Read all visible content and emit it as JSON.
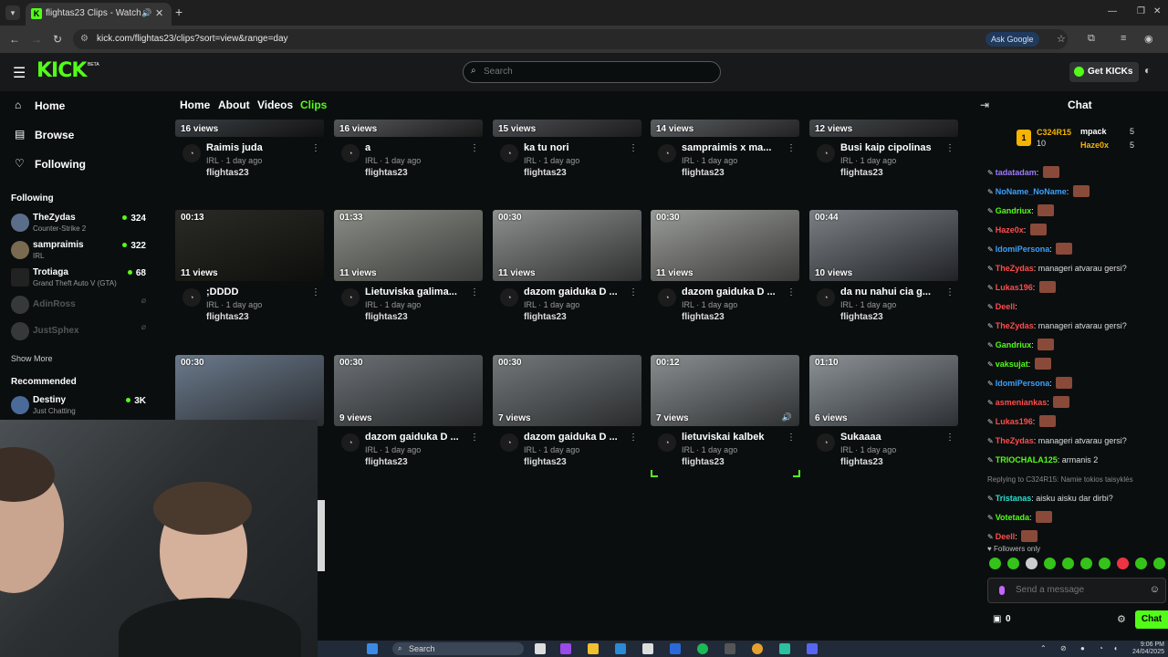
{
  "browser": {
    "tab_title": "flightas23 Clips - Watch Live",
    "url": "kick.com/flightas23/clips?sort=view&range=day",
    "ask_google": "Ask Google"
  },
  "header": {
    "logo": "KICK",
    "logo_badge": "BETA",
    "search_placeholder": "Search",
    "get_kicks": "Get KICKs"
  },
  "sidebar": {
    "nav": [
      {
        "label": "Home",
        "icon": "home-icon"
      },
      {
        "label": "Browse",
        "icon": "browse-icon"
      },
      {
        "label": "Following",
        "icon": "heart-icon"
      }
    ],
    "following_heading": "Following",
    "following": [
      {
        "name": "TheZydas",
        "game": "Counter-Strike 2",
        "viewers": "324",
        "live": true,
        "color": "#5a6e8a"
      },
      {
        "name": "sampraimis",
        "game": "IRL",
        "viewers": "322",
        "live": true,
        "color": "#7a6a50"
      },
      {
        "name": "Trotiaga",
        "game": "Grand Theft Auto V (GTA)",
        "viewers": "68",
        "live": true,
        "color": "#222222"
      },
      {
        "name": "AdinRoss",
        "game": "",
        "viewers": "",
        "live": false,
        "color": "#8a8a8a"
      },
      {
        "name": "JustSphex",
        "game": "",
        "viewers": "",
        "live": false,
        "color": "#8a8a8a"
      }
    ],
    "show_more": "Show More",
    "recommended_heading": "Recommended",
    "recommended": [
      {
        "name": "Destiny",
        "game": "Just Chatting",
        "viewers": "3K",
        "live": true,
        "color": "#4a6a9a"
      }
    ]
  },
  "profile_tabs": [
    {
      "label": "Home",
      "active": false
    },
    {
      "label": "About",
      "active": false
    },
    {
      "label": "Videos",
      "active": false
    },
    {
      "label": "Clips",
      "active": true
    }
  ],
  "clips": [
    {
      "duration": "",
      "views": "16 views",
      "title": "Raimis juda",
      "meta": "IRL · 1 day ago",
      "channel": "flightas23",
      "thumb": [
        "#3a3f44",
        "#111"
      ]
    },
    {
      "duration": "",
      "views": "16 views",
      "title": "a",
      "meta": "IRL · 1 day ago",
      "channel": "flightas23",
      "thumb": [
        "#55585a",
        "#1a1a1a"
      ]
    },
    {
      "duration": "",
      "views": "15 views",
      "title": "ka tu nori",
      "meta": "IRL · 1 day ago",
      "channel": "flightas23",
      "thumb": [
        "#4a4d52",
        "#1c1c1c"
      ]
    },
    {
      "duration": "",
      "views": "14 views",
      "title": "sampraimis x ma...",
      "meta": "IRL · 1 day ago",
      "channel": "flightas23",
      "thumb": [
        "#5a5e62",
        "#222"
      ]
    },
    {
      "duration": "",
      "views": "12 views",
      "title": "Busi kaip cipolinas",
      "meta": "IRL · 1 day ago",
      "channel": "flightas23",
      "thumb": [
        "#44484c",
        "#1a1a1a"
      ]
    },
    {
      "duration": "00:13",
      "views": "11 views",
      "title": ";DDDD",
      "meta": "IRL · 1 day ago",
      "channel": "flightas23",
      "thumb": [
        "#2a2a26",
        "#0e0e0c"
      ]
    },
    {
      "duration": "01:33",
      "views": "11 views",
      "title": "Lietuviska galima...",
      "meta": "IRL · 1 day ago",
      "channel": "flightas23",
      "thumb": [
        "#8a8c86",
        "#3a3c3a"
      ]
    },
    {
      "duration": "00:30",
      "views": "11 views",
      "title": "dazom gaiduka D ...",
      "meta": "IRL · 1 day ago",
      "channel": "flightas23",
      "thumb": [
        "#8e9090",
        "#2e3030"
      ]
    },
    {
      "duration": "00:30",
      "views": "11 views",
      "title": "dazom gaiduka D ...",
      "meta": "IRL · 1 day ago",
      "channel": "flightas23",
      "thumb": [
        "#9a9c9a",
        "#3a3a38"
      ]
    },
    {
      "duration": "00:44",
      "views": "10 views",
      "title": "da nu nahui cia g...",
      "meta": "IRL · 1 day ago",
      "channel": "flightas23",
      "thumb": [
        "#7c8084",
        "#202226"
      ]
    },
    {
      "duration": "00:30",
      "views": "",
      "title": "",
      "meta": "",
      "channel": "",
      "thumb": [
        "#6a7a8c",
        "#2a2c30"
      ]
    },
    {
      "duration": "00:30",
      "views": "9 views",
      "title": "dazom gaiduka D ...",
      "meta": "IRL · 1 day ago",
      "channel": "flightas23",
      "thumb": [
        "#6c7074",
        "#26282a"
      ]
    },
    {
      "duration": "00:30",
      "views": "7 views",
      "title": "dazom gaiduka D ...",
      "meta": "IRL · 1 day ago",
      "channel": "flightas23",
      "thumb": [
        "#74787a",
        "#2a2c2e"
      ]
    },
    {
      "duration": "00:12",
      "views": "7 views",
      "title": "lietuviskai kalbek",
      "meta": "IRL · 1 day ago",
      "channel": "flightas23",
      "thumb": [
        "#8a8e90",
        "#2e3032"
      ]
    },
    {
      "duration": "01:10",
      "views": "6 views",
      "title": "Sukaaaa",
      "meta": "IRL · 1 day ago",
      "channel": "flightas23",
      "thumb": [
        "#8c9296",
        "#2c3034"
      ]
    }
  ],
  "chat": {
    "title": "Chat",
    "pinned": [
      {
        "name": "C324R15",
        "count": "10",
        "color": "#f5b400"
      },
      {
        "name": "mpack",
        "count": "5",
        "color": "#ffffff"
      },
      {
        "name": "Haze0x",
        "count": "5",
        "color": "#f5b400"
      }
    ],
    "messages": [
      {
        "user": "tadatadam",
        "color": "#9a7cff",
        "text": "",
        "emote": true
      },
      {
        "user": "NoName_NoName",
        "color": "#3aa0ff",
        "text": "",
        "emote": true
      },
      {
        "user": "Gandriux",
        "color": "#53fc18",
        "text": "",
        "emote": true
      },
      {
        "user": "Haze0x",
        "color": "#ff4d4d",
        "text": "",
        "emote": true
      },
      {
        "user": "IdomiPersona",
        "color": "#3aa0ff",
        "text": "",
        "emote": true
      },
      {
        "user": "TheZydas",
        "color": "#ff4d4d",
        "text": "manageri atvarau gersi?",
        "emote": false
      },
      {
        "user": "Lukas196",
        "color": "#ff4d4d",
        "text": "",
        "emote": true
      },
      {
        "user": "Deell",
        "color": "#ff4d4d",
        "text": "",
        "emote": false
      },
      {
        "user": "TheZydas",
        "color": "#ff4d4d",
        "text": "manageri atvarau gersi?",
        "emote": false
      },
      {
        "user": "Gandriux",
        "color": "#53fc18",
        "text": "",
        "emote": true
      },
      {
        "user": "vaksujat",
        "color": "#53fc18",
        "text": "",
        "emote": true
      },
      {
        "user": "IdomiPersona",
        "color": "#3aa0ff",
        "text": "",
        "emote": true
      },
      {
        "user": "asmeniankas",
        "color": "#ff4d4d",
        "text": "",
        "emote": true
      },
      {
        "user": "Lukas196",
        "color": "#ff4d4d",
        "text": "",
        "emote": true
      },
      {
        "user": "TheZydas",
        "color": "#ff4d4d",
        "text": "manageri atvarau gersi?",
        "emote": false
      },
      {
        "user": "TRIOCHALA125",
        "color": "#53fc18",
        "text": "armanis 2",
        "emote": false
      },
      {
        "user": "Replying to C324R15: Namie tokios taisyklės",
        "color": "#888888",
        "text": "",
        "emote": false
      },
      {
        "user": "Tristanas",
        "color": "#2be0d0",
        "text": "aisku aisku dar dirbi?",
        "emote": false
      },
      {
        "user": "Votetada",
        "color": "#53fc18",
        "text": "",
        "emote": true
      },
      {
        "user": "Deell",
        "color": "#ff4d4d",
        "text": "",
        "emote": true
      }
    ],
    "followers_only": "Followers only",
    "input_placeholder": "Send a message",
    "kicks_count": "0",
    "send_label": "Chat"
  },
  "taskbar": {
    "search_label": "Search",
    "time": "9:06 PM",
    "date": "24/04/2025"
  }
}
